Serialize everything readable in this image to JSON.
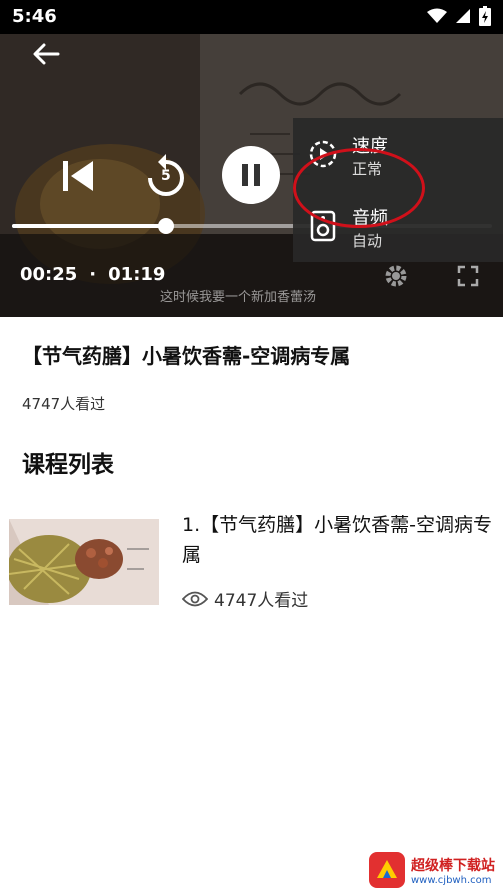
{
  "status_bar": {
    "time": "5:46"
  },
  "player": {
    "current_time": "00:25",
    "separator": "·",
    "duration": "01:19",
    "progress_fraction": 0.32,
    "replay_seconds": "5",
    "subtitle_text": "这时候我要一个新加香蕾汤",
    "menu": [
      {
        "title": "速度",
        "value": "正常",
        "icon": "speed-icon"
      },
      {
        "title": "音频",
        "value": "自动",
        "icon": "speaker-icon"
      }
    ]
  },
  "content": {
    "title": "【节气药膳】小暑饮香薷-空调病专属",
    "views": "4747人看过",
    "section_title": "课程列表"
  },
  "lessons": [
    {
      "title": "1.【节气药膳】小暑饮香薷-空调病专属",
      "views": "4747人看过"
    }
  ],
  "watermark": {
    "line1": "超级棒下载站",
    "line2": "www.cjbwh.com"
  },
  "colors": {
    "highlight_ring": "#d0101a",
    "menu_bg": "#282828"
  }
}
